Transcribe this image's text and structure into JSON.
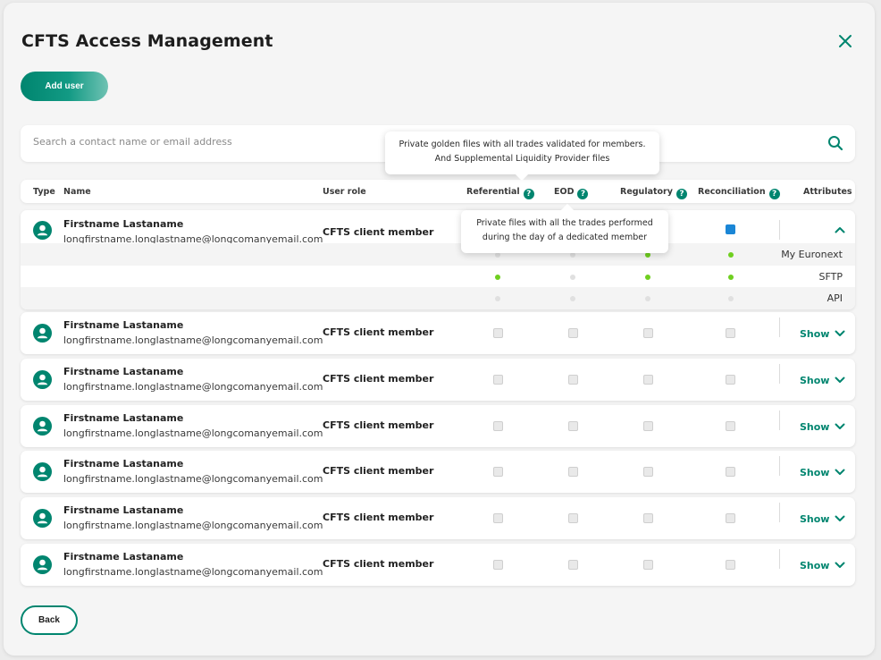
{
  "window": {
    "title": "CFTS Access Management"
  },
  "toolbar": {
    "add_user_label": "Add user"
  },
  "search": {
    "placeholder": "Search a contact name or email address"
  },
  "table": {
    "headers": {
      "type": "Type",
      "name": "Name",
      "user_role": "User role",
      "referential": "Referential",
      "eod": "EOD",
      "regulatory": "Regulatory",
      "reconciliation": "Reconciliation",
      "attributes": "Attributes"
    },
    "tooltips": {
      "referential": [
        "Private golden files with all trades validated for members.",
        "And Supplemental Liquidity Provider files"
      ],
      "eod": [
        "Private files with all the trades performed",
        "during the day of a dedicated member"
      ]
    },
    "expanded_user": {
      "name": "Firstname Lastaname",
      "email": "longfirstname.longlastname@longcomanyemail.com",
      "role": "CFTS client member",
      "reconciliation_checked": true,
      "attributes": [
        {
          "label": "My Euronext",
          "referential": false,
          "eod": false,
          "regulatory": true,
          "reconciliation": true
        },
        {
          "label": "SFTP",
          "referential": true,
          "eod": false,
          "regulatory": true,
          "reconciliation": true
        },
        {
          "label": "API",
          "referential": false,
          "eod": false,
          "regulatory": false,
          "reconciliation": false
        }
      ]
    },
    "rows": [
      {
        "name": "Firstname Lastaname",
        "email": "longfirstname.longlastname@longcomanyemail.com",
        "role": "CFTS client member",
        "action": "Show"
      },
      {
        "name": "Firstname Lastaname",
        "email": "longfirstname.longlastname@longcomanyemail.com",
        "role": "CFTS client member",
        "action": "Show"
      },
      {
        "name": "Firstname Lastaname",
        "email": "longfirstname.longlastname@longcomanyemail.com",
        "role": "CFTS client member",
        "action": "Show"
      },
      {
        "name": "Firstname Lastaname",
        "email": "longfirstname.longlastname@longcomanyemail.com",
        "role": "CFTS client member",
        "action": "Show"
      },
      {
        "name": "Firstname Lastaname",
        "email": "longfirstname.longlastname@longcomanyemail.com",
        "role": "CFTS client member",
        "action": "Show"
      },
      {
        "name": "Firstname Lastaname",
        "email": "longfirstname.longlastname@longcomanyemail.com",
        "role": "CFTS client member",
        "action": "Show"
      }
    ]
  },
  "footer": {
    "back_label": "Back"
  },
  "colors": {
    "accent": "#00856f",
    "check_blue": "#1a86d6",
    "dot_on": "#6fcf1f",
    "dot_off": "#e0e0e0"
  },
  "icons": {
    "close": "close-icon",
    "search": "search-icon",
    "help": "question-circle-icon",
    "avatar": "user-avatar-icon",
    "expand": "chevron-down-icon",
    "collapse": "chevron-up-icon"
  }
}
